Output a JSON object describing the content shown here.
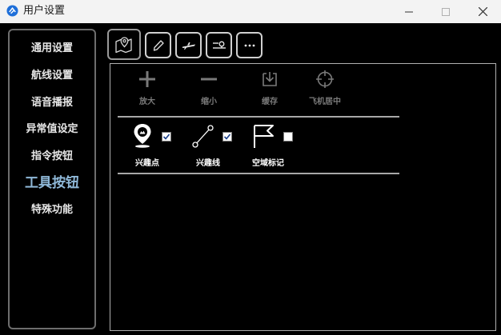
{
  "window": {
    "title": "用户设置"
  },
  "sidebar": {
    "items": [
      {
        "label": "通用设置"
      },
      {
        "label": "航线设置"
      },
      {
        "label": "语音播报"
      },
      {
        "label": "异常值设定"
      },
      {
        "label": "指令按钮"
      },
      {
        "label": "工具按钮",
        "active": true
      },
      {
        "label": "特殊功能"
      }
    ]
  },
  "tool_tabs": [
    {
      "icon": "map-pin-icon",
      "active": true
    },
    {
      "icon": "pencil-icon"
    },
    {
      "icon": "airplane-icon"
    },
    {
      "icon": "route-icon"
    },
    {
      "icon": "more-icon"
    }
  ],
  "toolbar": {
    "buttons": [
      {
        "label": "放大",
        "icon": "plus-icon"
      },
      {
        "label": "缩小",
        "icon": "minus-icon"
      },
      {
        "label": "缓存",
        "icon": "download-icon"
      },
      {
        "label": "飞机居中",
        "icon": "crosshair-icon"
      }
    ]
  },
  "layers": [
    {
      "label": "兴趣点",
      "icon": "poi-icon",
      "checked": true
    },
    {
      "label": "兴趣线",
      "icon": "line-icon",
      "checked": true
    },
    {
      "label": "空域标记",
      "icon": "flag-icon",
      "checked": false
    }
  ],
  "colors": {
    "background": "#000000",
    "active_nav": "#8fb8d8",
    "checkbox_check": "#1a3f8a"
  }
}
